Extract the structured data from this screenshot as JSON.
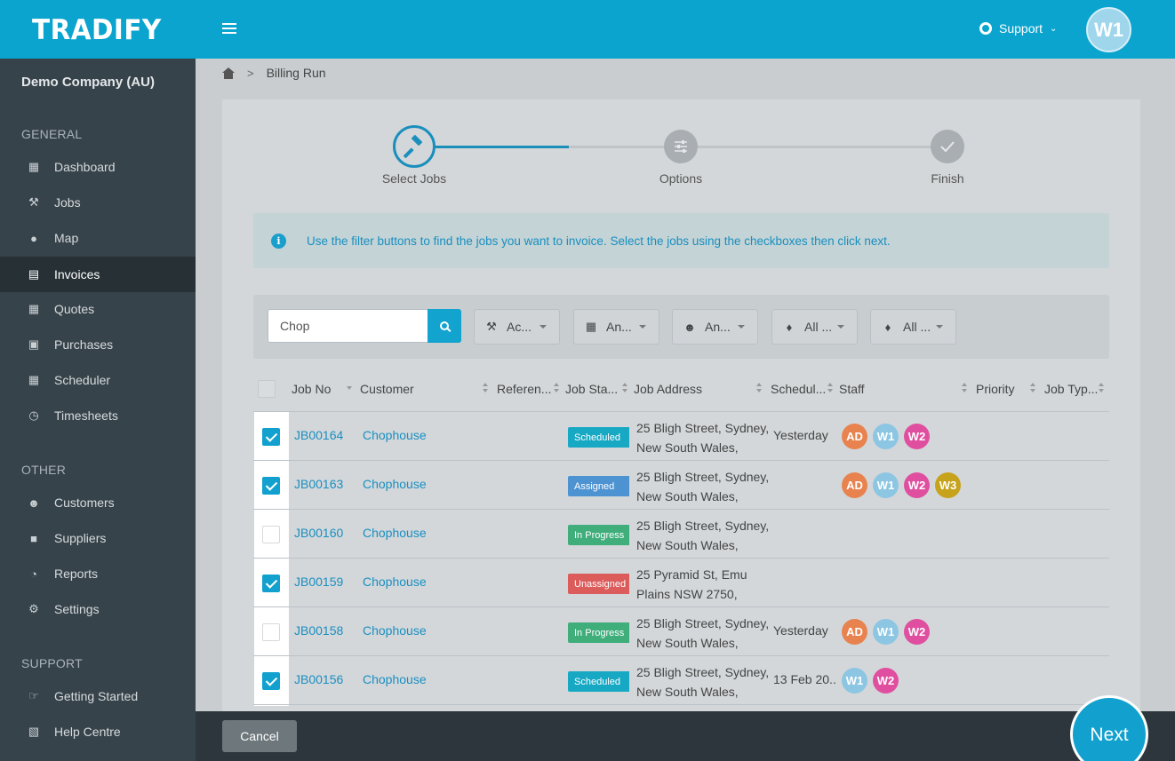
{
  "header": {
    "logo": "TRADIFY",
    "support_label": "Support",
    "user_initials": "W1"
  },
  "sidebar": {
    "company": "Demo Company (AU)",
    "sections": [
      {
        "label": "GENERAL",
        "items": [
          {
            "label": "Dashboard",
            "icon": "dashboard-icon"
          },
          {
            "label": "Jobs",
            "icon": "hammer-icon"
          },
          {
            "label": "Map",
            "icon": "map-marker-icon"
          },
          {
            "label": "Invoices",
            "icon": "invoice-icon",
            "active": true
          },
          {
            "label": "Quotes",
            "icon": "calculator-icon"
          },
          {
            "label": "Purchases",
            "icon": "cart-icon"
          },
          {
            "label": "Scheduler",
            "icon": "calendar-icon"
          },
          {
            "label": "Timesheets",
            "icon": "clock-icon"
          }
        ]
      },
      {
        "label": "OTHER",
        "items": [
          {
            "label": "Customers",
            "icon": "users-icon"
          },
          {
            "label": "Suppliers",
            "icon": "truck-icon"
          },
          {
            "label": "Reports",
            "icon": "pie-chart-icon"
          },
          {
            "label": "Settings",
            "icon": "gear-icon"
          }
        ]
      },
      {
        "label": "SUPPORT",
        "items": [
          {
            "label": "Getting Started",
            "icon": "thumbs-up-icon"
          },
          {
            "label": "Help Centre",
            "icon": "book-icon"
          }
        ]
      }
    ]
  },
  "breadcrumb": {
    "current": "Billing Run"
  },
  "wizard": {
    "steps": [
      {
        "label": "Select Jobs",
        "state": "active"
      },
      {
        "label": "Options",
        "state": "pending"
      },
      {
        "label": "Finish",
        "state": "pending"
      }
    ],
    "progress_fraction": 0.29
  },
  "info": {
    "text": "Use the filter buttons to find the jobs you want to invoice. Select the jobs using the checkboxes then click next."
  },
  "filters": {
    "search_value": "Chop",
    "buttons": [
      {
        "label": "Ac...",
        "icon": "wrench-icon"
      },
      {
        "label": "An...",
        "icon": "calendar-icon"
      },
      {
        "label": "An...",
        "icon": "users-icon"
      },
      {
        "label": "All ...",
        "icon": "tag-icon"
      },
      {
        "label": "All ...",
        "icon": "tag-icon"
      }
    ]
  },
  "table": {
    "columns": [
      "Job No",
      "Customer",
      "Referen...",
      "Job Sta...",
      "Job Address",
      "Schedul...",
      "Staff",
      "Priority",
      "Job Typ..."
    ],
    "rows": [
      {
        "checked": true,
        "job_no": "JB00164",
        "customer": "Chophouse",
        "status": "Scheduled",
        "status_color": "#17a9c4",
        "address1": "25 Bligh Street, Sydney,",
        "address2": "New South Wales,",
        "scheduled": "Yesterday",
        "staff": [
          "AD",
          "W1",
          "W2"
        ]
      },
      {
        "checked": true,
        "job_no": "JB00163",
        "customer": "Chophouse",
        "status": "Assigned",
        "status_color": "#4d93d1",
        "address1": "25 Bligh Street, Sydney,",
        "address2": "New South Wales,",
        "scheduled": "",
        "staff": [
          "AD",
          "W1",
          "W2",
          "W3"
        ]
      },
      {
        "checked": false,
        "job_no": "JB00160",
        "customer": "Chophouse",
        "status": "In Progress",
        "status_color": "#3fae7b",
        "address1": "25 Bligh Street, Sydney,",
        "address2": "New South Wales,",
        "scheduled": "",
        "staff": []
      },
      {
        "checked": true,
        "job_no": "JB00159",
        "customer": "Chophouse",
        "status": "Unassigned",
        "status_color": "#dc5b5b",
        "address1": "25 Pyramid St, Emu",
        "address2": "Plains NSW 2750,",
        "scheduled": "",
        "staff": []
      },
      {
        "checked": false,
        "job_no": "JB00158",
        "customer": "Chophouse",
        "status": "In Progress",
        "status_color": "#3fae7b",
        "address1": "25 Bligh Street, Sydney,",
        "address2": "New South Wales,",
        "scheduled": "Yesterday",
        "staff": [
          "AD",
          "W1",
          "W2"
        ]
      },
      {
        "checked": true,
        "job_no": "JB00156",
        "customer": "Chophouse",
        "status": "Scheduled",
        "status_color": "#17a9c4",
        "address1": "25 Bligh Street, Sydney,",
        "address2": "New South Wales,",
        "scheduled": "13 Feb 20..",
        "staff": [
          "W1",
          "W2"
        ]
      }
    ],
    "staff_colors": {
      "AD": "#e8834f",
      "W1": "#8dc6e2",
      "W2": "#e04f9f",
      "W3": "#c7a21b"
    }
  },
  "footer": {
    "cancel_label": "Cancel",
    "next_label": "Next"
  }
}
